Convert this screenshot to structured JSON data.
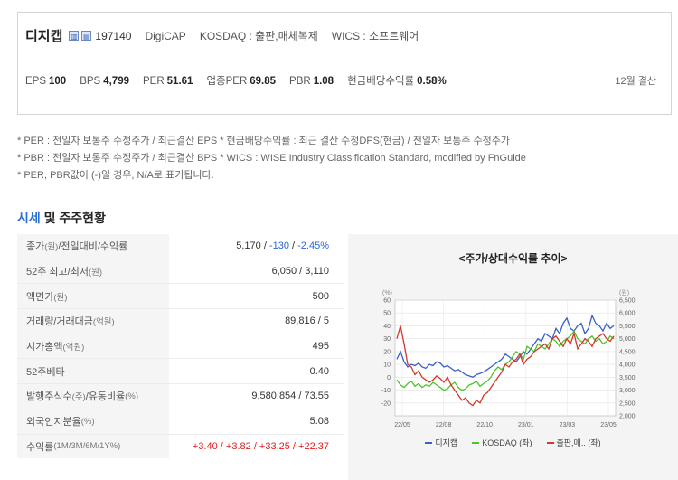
{
  "company": {
    "name": "디지캡",
    "code": "197140",
    "english_name": "DigiCAP",
    "market": "KOSDAQ : 출판,매체복제",
    "wics": "WICS : 소프트웨어",
    "icons": [
      "building-icon",
      "document-icon"
    ]
  },
  "stats": [
    {
      "label": "EPS",
      "value": "100"
    },
    {
      "label": "BPS",
      "value": "4,799"
    },
    {
      "label": "PER",
      "value": "51.61"
    },
    {
      "label": "업종PER",
      "value": "69.85"
    },
    {
      "label": "PBR",
      "value": "1.08"
    },
    {
      "label": "현금배당수익률",
      "value": "0.58%"
    }
  ],
  "fiscal": "12월 결산",
  "notes": [
    "* PER : 전일자 보통주 수정주가 / 최근결산 EPS * 현금배당수익률 : 최근 결산 수정DPS(현금) / 전일자 보통주 수정주가",
    "* PBR : 전일자 보통주 수정주가 / 최근결산 BPS * WICS : WISE Industry Classification Standard, modified by FnGuide",
    "* PER, PBR값이 (-)일 경우, N/A로 표기됩니다."
  ],
  "section": {
    "highlight": "시세",
    "rest": " 및 주주현황"
  },
  "table": {
    "rows": [
      {
        "label": "종가",
        "unit": "(원)",
        "label2": "/전일대비/수익률",
        "value": "5,170 / "
      },
      {
        "label": "52주 최고/최저",
        "unit": "(원)",
        "value": "6,050 / 3,110"
      },
      {
        "label": "액면가",
        "unit": "(원)",
        "value": "500"
      },
      {
        "label": "거래량/거래대금",
        "unit": "(억원)",
        "value": "89,816 / 5"
      },
      {
        "label": "시가총액",
        "unit": "(억원)",
        "value": "495"
      },
      {
        "label": "52주베타",
        "unit": "",
        "value": "0.40"
      },
      {
        "label": "발행주식수",
        "unit": "(주)",
        "label2": "/유동비율",
        "unit2": "(%)",
        "value": "9,580,854 / 73.55"
      },
      {
        "label": "외국인지분율",
        "unit": "(%)",
        "value": "5.08"
      },
      {
        "label": "수익률",
        "unit": "(1M/3M/6M/1Y%)",
        "value": ""
      }
    ],
    "change": "-130",
    "change_sep": " / ",
    "change_pct": "-2.45%",
    "returns": "+3.40 / +3.82 / +33.25 / +22.37"
  },
  "chart_data": {
    "type": "line",
    "title": "<주가/상대수익률 추이>",
    "y_left_unit": "(%)",
    "y_right_unit": "(원)",
    "y_left_ticks": [
      "60",
      "50",
      "40",
      "30",
      "20",
      "10",
      "0",
      "-10",
      "-20"
    ],
    "y_right_ticks": [
      "6,500",
      "6,000",
      "5,500",
      "5,000",
      "4,500",
      "4,000",
      "3,500",
      "3,000",
      "2,500",
      "2,000"
    ],
    "x_ticks": [
      "22/05",
      "22/08",
      "22/10",
      "23/01",
      "23/03",
      "23/05"
    ],
    "ylim_left": [
      -30,
      60
    ],
    "ylim_right": [
      2000,
      6500
    ],
    "grid": true,
    "legend_position": "bottom",
    "series": [
      {
        "name": "디지캡",
        "color": "#3b5fc9",
        "axis": "right",
        "values": [
          4200,
          4500,
          4100,
          3900,
          4000,
          3950,
          4050,
          3900,
          3850,
          4000,
          3950,
          4100,
          4050,
          3900,
          3950,
          3850,
          3750,
          3800,
          3700,
          3600,
          3550,
          3500,
          3600,
          3650,
          3700,
          3800,
          3900,
          4000,
          4100,
          4200,
          4400,
          4300,
          4200,
          4100,
          4300,
          4500,
          4400,
          4600,
          4800,
          5000,
          4900,
          5200,
          5100,
          5000,
          5400,
          5200,
          5600,
          5800,
          5400,
          5300,
          5500,
          5600,
          5200,
          5400,
          5900,
          5600,
          5500,
          5300,
          5600,
          5400,
          5500
        ]
      },
      {
        "name": "KOSDAQ (좌)",
        "color": "#4cc42c",
        "axis": "left",
        "values": [
          -2,
          -6,
          -8,
          -5,
          -3,
          -7,
          -5,
          -8,
          -6,
          -7,
          -4,
          -6,
          -8,
          -10,
          -9,
          -6,
          -4,
          -8,
          -10,
          -9,
          -6,
          -5,
          -3,
          -7,
          -5,
          -3,
          0,
          5,
          8,
          6,
          10,
          12,
          16,
          20,
          18,
          14,
          24,
          22,
          20,
          26,
          24,
          22,
          26,
          30,
          28,
          24,
          28,
          30,
          32,
          36,
          30,
          28,
          26,
          30,
          32,
          28,
          30,
          26,
          28,
          32,
          30
        ]
      },
      {
        "name": "출판,매.. (좌)",
        "color": "#d03a2a",
        "axis": "left",
        "values": [
          30,
          40,
          26,
          10,
          8,
          2,
          5,
          0,
          -2,
          -4,
          -2,
          1,
          -1,
          -4,
          0,
          -6,
          -10,
          -14,
          -18,
          -16,
          -20,
          -22,
          -18,
          -20,
          -14,
          -12,
          -8,
          -4,
          0,
          4,
          10,
          8,
          12,
          14,
          18,
          10,
          14,
          16,
          20,
          22,
          24,
          26,
          22,
          30,
          32,
          28,
          24,
          30,
          26,
          34,
          22,
          26,
          30,
          28,
          24,
          30,
          32,
          34,
          30,
          28,
          32
        ]
      }
    ]
  }
}
